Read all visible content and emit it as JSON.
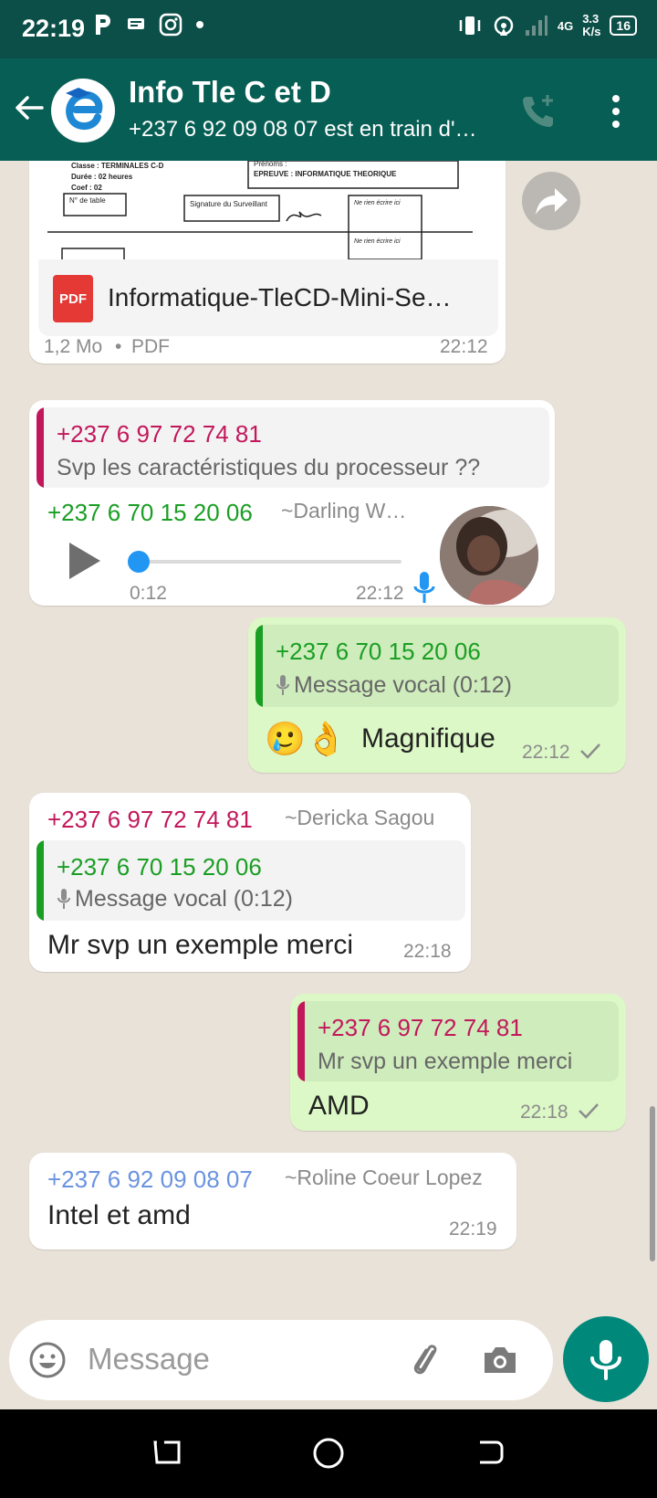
{
  "status_bar": {
    "time": "22:19",
    "network_gen": "4G",
    "speed": "3.3",
    "speed_unit": "K/s",
    "battery": "16"
  },
  "header": {
    "title": "Info Tle C et D",
    "subtitle": "+237 6 92 09 08 07 est en train d'…"
  },
  "document_message": {
    "preview_lines": {
      "classe": "Classe : TERMINALES C-D",
      "duree": "Durée : 02 heures",
      "coef": "Coef : 02",
      "table": "N° de table",
      "prenoms": "Prénoms :",
      "epreuve": "EPREUVE : INFORMATIQUE THEORIQUE",
      "signature": "Signature du Surveillant",
      "rien1": "Ne rien écrire ici",
      "rien2": "Ne rien écrire ici"
    },
    "file_icon_label": "PDF",
    "file_name": "Informatique-TleCD-Mini-Se…",
    "size": "1,2 Mo",
    "dot": "•",
    "type": "PDF",
    "time": "22:12"
  },
  "messages": [
    {
      "quote_sender": "+237 6 97 72 74 81",
      "quote_text": "Svp les caractéristiques du processeur ??",
      "sender": "+237 6 70 15 20 06",
      "alias": "~Darling W…",
      "voice_duration": "0:12",
      "time": "22:12"
    },
    {
      "quote_sender": "+237 6 70 15 20 06",
      "quote_text": "Message vocal (0:12)",
      "text": "Magnifique",
      "emojis": "🥲👌",
      "time": "22:12"
    },
    {
      "sender": "+237 6 97 72 74 81",
      "alias": "~Dericka Sagou",
      "quote_sender": "+237 6 70 15 20 06",
      "quote_text": "Message vocal (0:12)",
      "text": "Mr svp un exemple merci",
      "time": "22:18"
    },
    {
      "quote_sender": "+237 6 97 72 74 81",
      "quote_text": "Mr svp un exemple merci",
      "text": "AMD",
      "time": "22:18"
    },
    {
      "sender": "+237 6 92 09 08 07",
      "alias": "~Roline Coeur Lopez",
      "text": "Intel et amd",
      "time": "22:19"
    }
  ],
  "input": {
    "placeholder": "Message"
  },
  "colors": {
    "header": "#075e54",
    "status_bar": "#0c4f48",
    "out_bubble": "#dcf8c6",
    "sender_magenta": "#c2185b",
    "sender_green": "#1a9e24",
    "sender_blue": "#6a93e0",
    "accent": "#00897b"
  },
  "icons": {
    "back": "arrow-left-icon",
    "call": "add-call-icon",
    "menu": "more-vert-icon",
    "forward": "forward-icon",
    "play": "play-icon",
    "mic": "mic-icon",
    "emoji": "emoji-icon",
    "attach": "paperclip-icon",
    "camera": "camera-icon"
  }
}
